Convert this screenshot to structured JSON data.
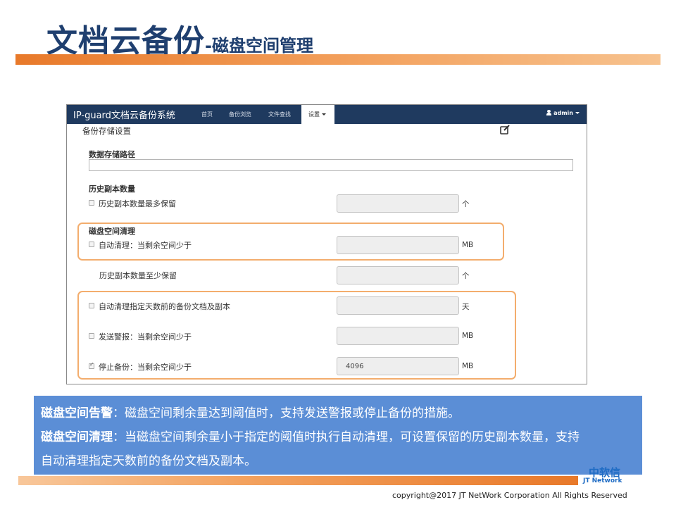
{
  "slide": {
    "title_main": "文档云备份",
    "title_sub": "-磁盘空间管理"
  },
  "app": {
    "brand": "IP-guard文档云备份系统",
    "nav_items": [
      "首页",
      "备份浏览",
      "文件查找"
    ],
    "nav_active": "设置",
    "user": "admin",
    "panel_title": "备份存储设置",
    "sections": {
      "storage_path": "数据存储路径",
      "history_count": "历史副本数量",
      "cleanup": "磁盘空间清理"
    },
    "rows": {
      "history_max": "历史副本数量最多保留",
      "auto_clean": "自动清理：当剩余空间少于",
      "history_min": "历史副本数量至少保留",
      "auto_clean_days": "自动清理指定天数前的备份文档及副本",
      "send_alert": "发送警报：当剩余空间少于",
      "stop_backup": "停止备份：当剩余空间少于"
    },
    "units": {
      "count": "个",
      "mb": "MB",
      "day": "天"
    },
    "stop_backup_value": "4096",
    "checkboxes": {
      "history_max": false,
      "auto_clean": false,
      "auto_clean_days": false,
      "send_alert": false,
      "stop_backup": true
    }
  },
  "info": {
    "alert_term": "磁盘空间告警",
    "alert_text": "：磁盘空间剩余量达到阈值时，支持发送警报或停止备份的措施。",
    "clean_term": "磁盘空间清理",
    "clean_text": "：当磁盘空间剩余量小于指定的阈值时执行自动清理，可设置保留的历史副本数量，支持",
    "clean_text_2": "自动清理指定天数前的备份文档及副本。"
  },
  "footer": {
    "logo_cn": "中软信",
    "logo_en": "JT Network",
    "copyright": "copyright@2017  JT NetWork Corporation All Rights Reserved"
  },
  "colors": {
    "title": "#1f3f6f",
    "navbar": "#1f3a5f",
    "accent_orange": "#f3ad6d",
    "info_bg": "#5b8ed6"
  }
}
